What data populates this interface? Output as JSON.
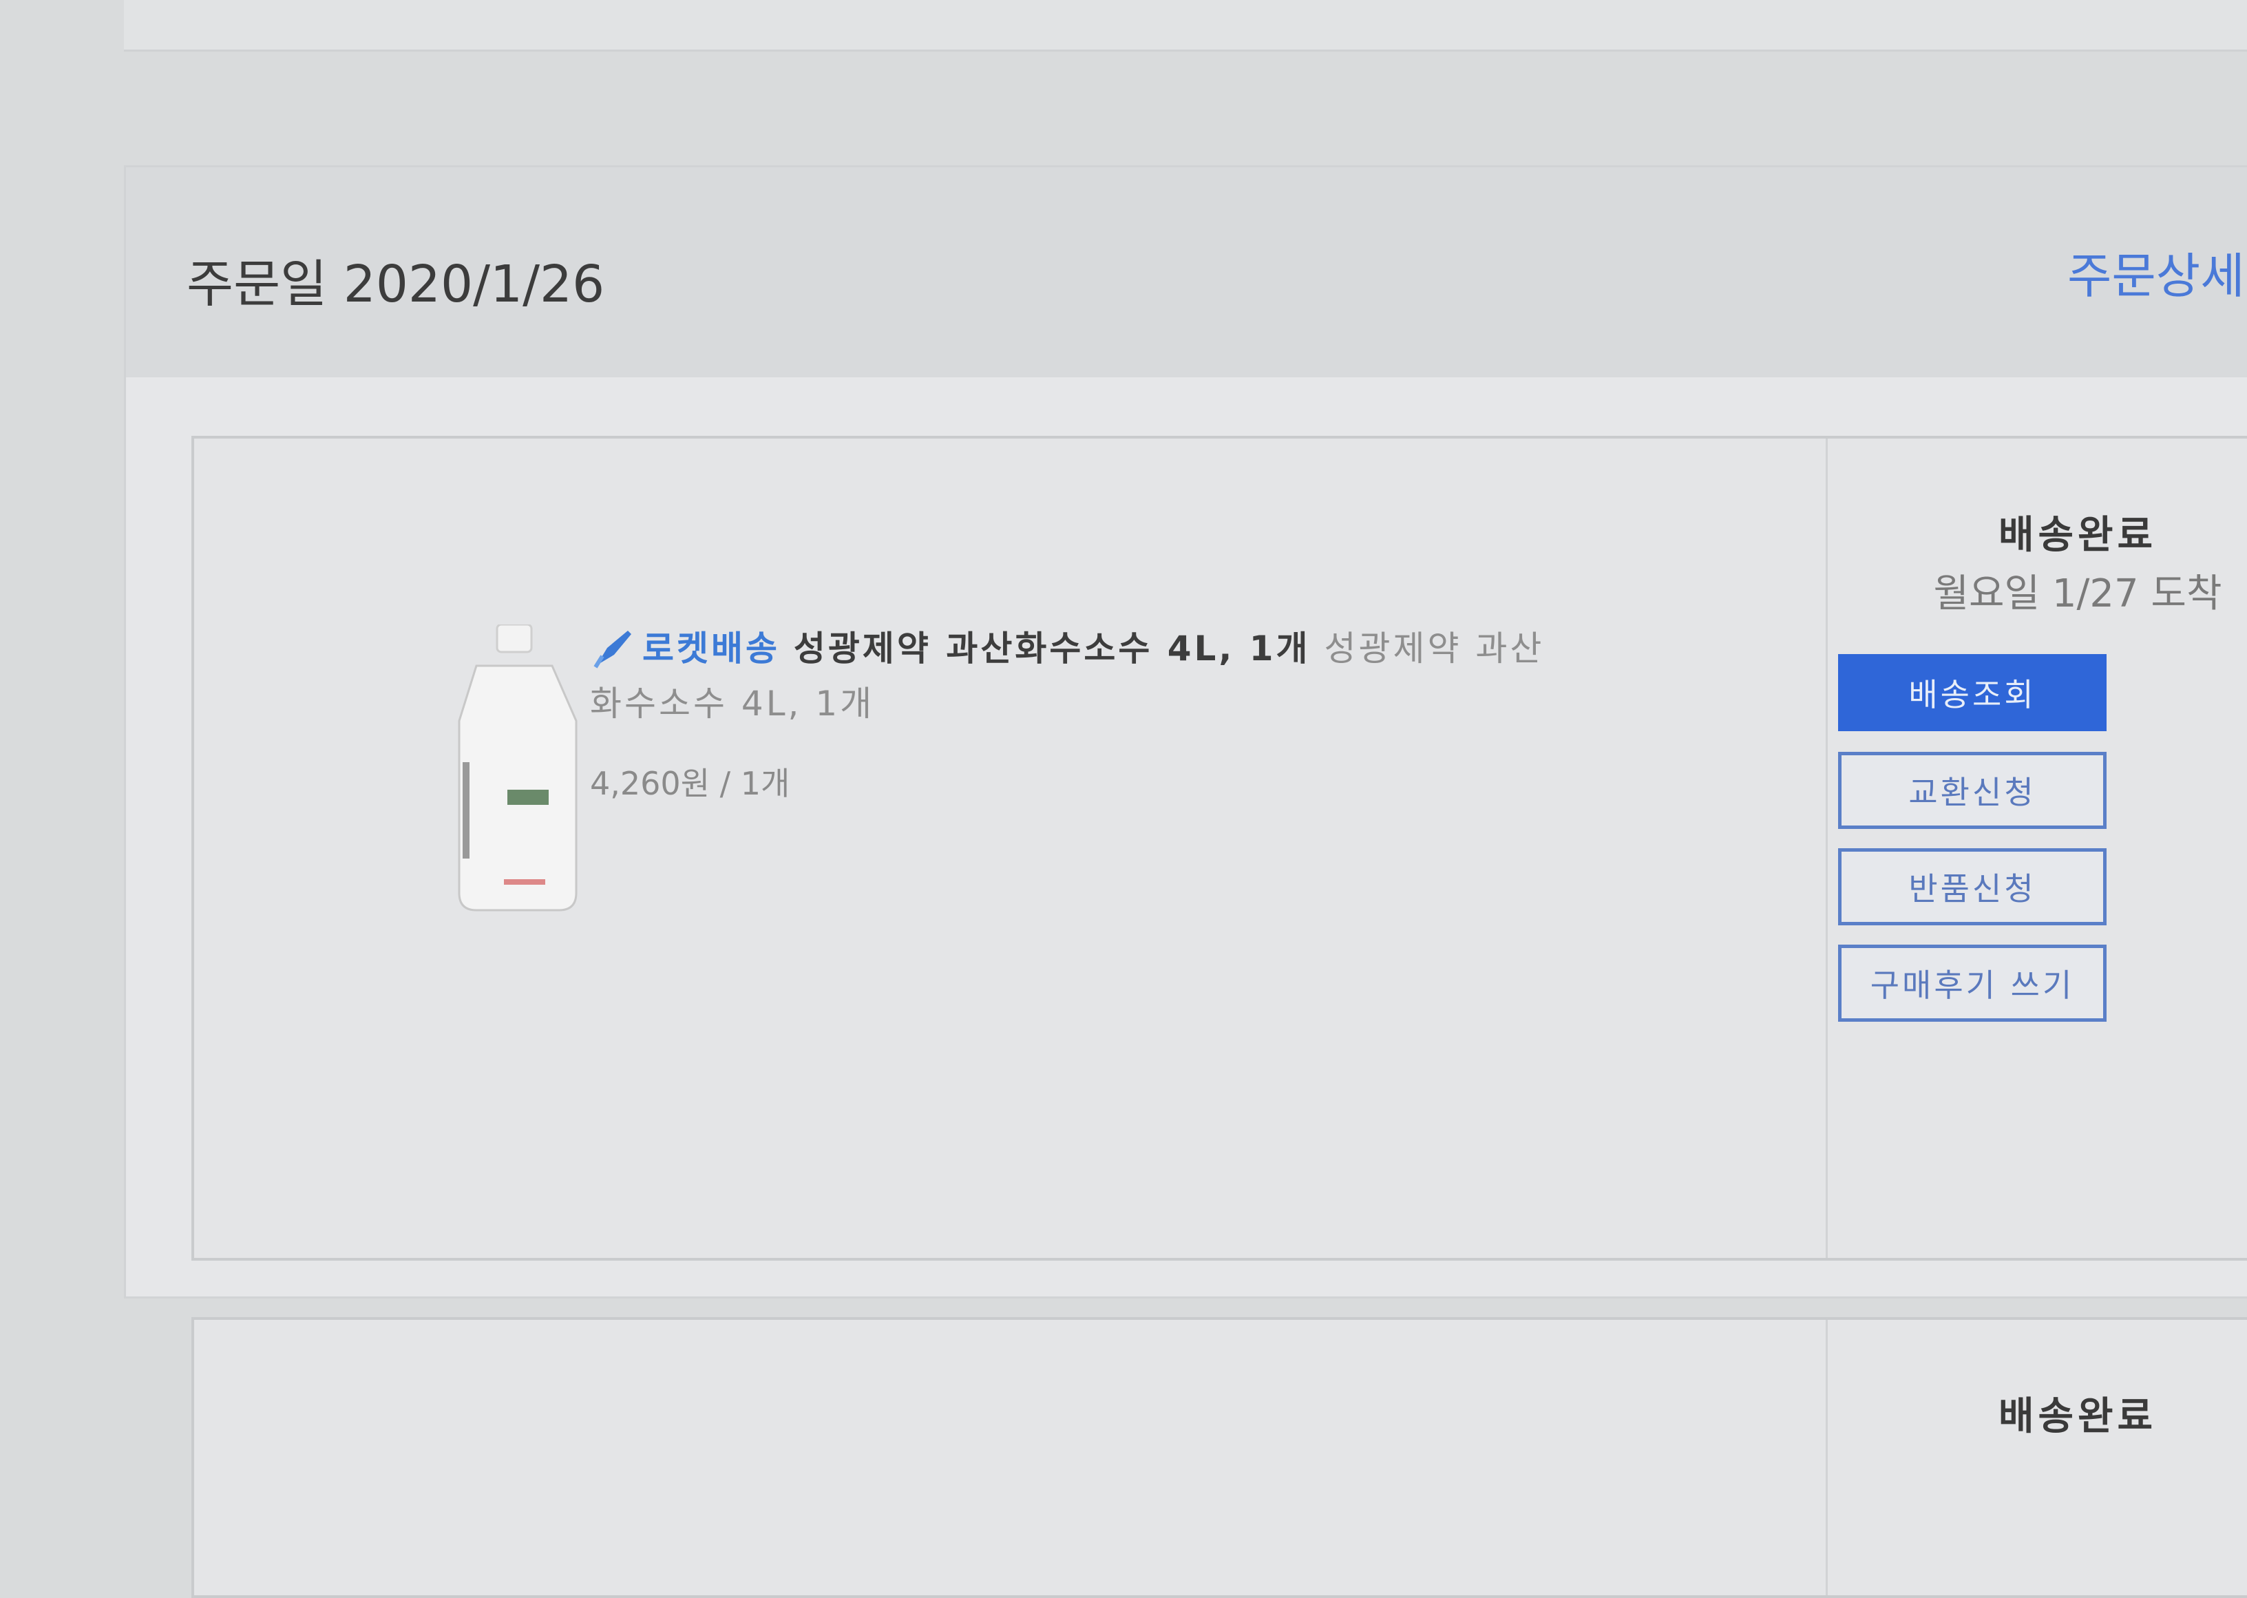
{
  "order": {
    "date_label": "주문일 2020/1/26",
    "detail_link": "주문상세"
  },
  "item": {
    "rocket_label": "로켓배송",
    "title": "성광제약 과산화수소수 4L, 1개",
    "subtitle_line1": "성광제약 과산",
    "subtitle_line2": "화수소수 4L, 1개",
    "price": "4,260원 / 1개",
    "status_title": "배송완료",
    "status_sub": "월요일 1/27 도착",
    "buttons": {
      "track": "배송조회",
      "exchange": "교환신청",
      "return": "반품신청",
      "review": "구매후기 쓰기"
    }
  },
  "next_item": {
    "status_title": "배송완료"
  },
  "colors": {
    "primary": "#2f66d8",
    "link": "#4a79d8"
  }
}
